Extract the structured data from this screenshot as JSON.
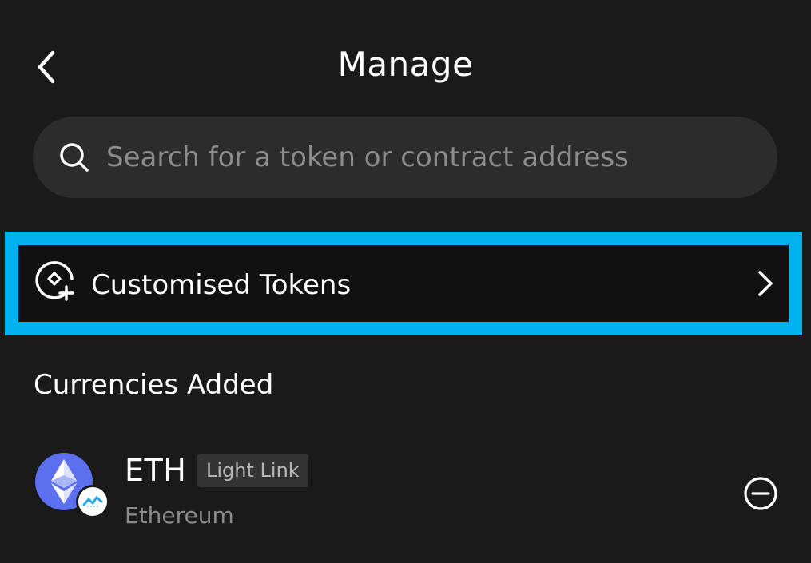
{
  "header": {
    "title": "Manage"
  },
  "search": {
    "placeholder": "Search for a token or contract address",
    "value": ""
  },
  "customised_tokens": {
    "label": "Customised Tokens"
  },
  "currencies_section": {
    "title": "Currencies Added",
    "items": [
      {
        "symbol": "ETH",
        "network_tag": "Light Link",
        "name": "Ethereum"
      }
    ]
  },
  "colors": {
    "background": "#1a1a1a",
    "search_background": "#2c2c2c",
    "highlight_border": "#00b2ef",
    "eth_brand": "#5b6ff0",
    "muted_text": "#8a8a8a"
  },
  "icons": {
    "back": "chevron-left-icon",
    "search": "search-icon",
    "customised_tokens": "token-plus-icon",
    "customised_tokens_arrow": "chevron-right-icon",
    "eth_logo": "ethereum-logo-icon",
    "chain_badge": "lightlink-badge-icon",
    "remove": "minus-circle-icon"
  }
}
